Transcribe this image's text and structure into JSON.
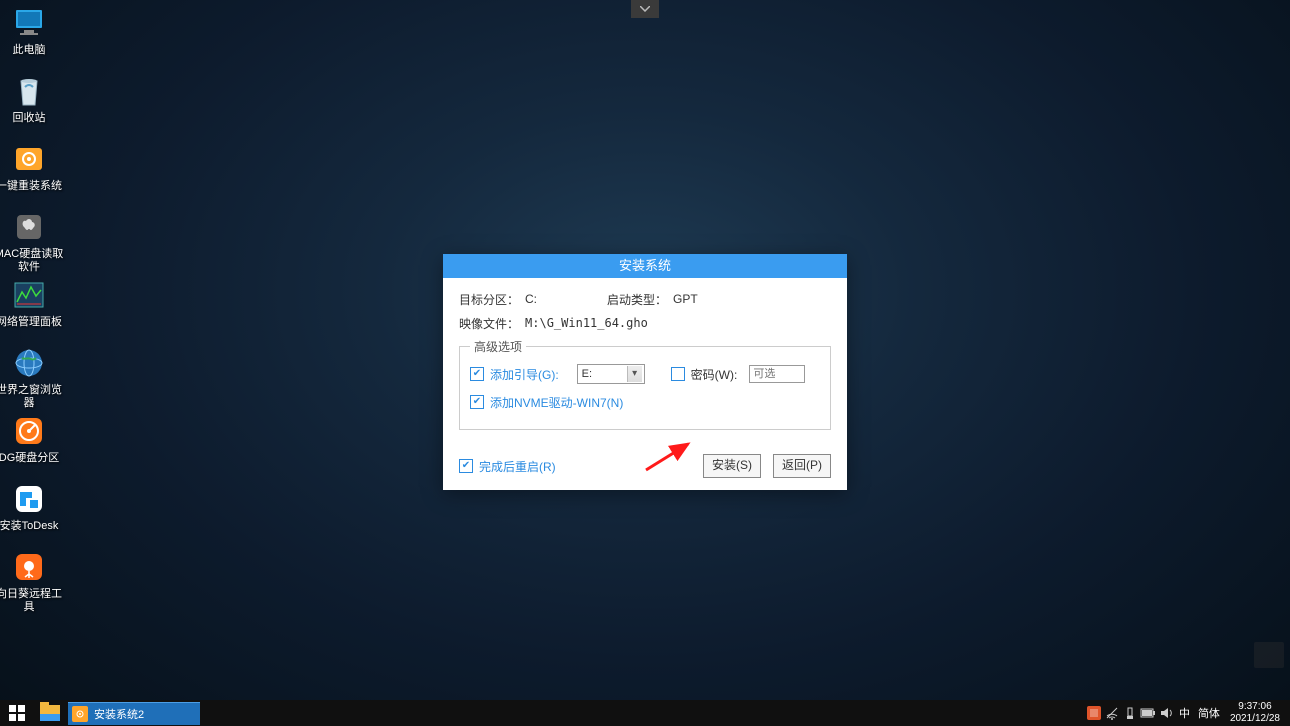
{
  "desktop_icons": [
    {
      "id": "this-pc",
      "label": "此电脑"
    },
    {
      "id": "recycle-bin",
      "label": "回收站"
    },
    {
      "id": "one-click-install",
      "label": "一键重装系统"
    },
    {
      "id": "mac-disk-read",
      "label": "MAC硬盘读取软件"
    },
    {
      "id": "network-panel",
      "label": "网络管理面板"
    },
    {
      "id": "world-browser",
      "label": "世界之窗浏览器"
    },
    {
      "id": "dg-partition",
      "label": "DG硬盘分区"
    },
    {
      "id": "install-todesk",
      "label": "安装ToDesk"
    },
    {
      "id": "sunflower-remote",
      "label": "向日葵远程工具"
    }
  ],
  "dialog": {
    "title": "安装系统",
    "target_label": "目标分区：",
    "target_value": "C:",
    "boot_label": "启动类型：",
    "boot_value": "GPT",
    "image_label": "映像文件：",
    "image_value": "M:\\G_Win11_64.gho",
    "advanced_legend": "高级选项",
    "add_boot_label": "添加引导(G):",
    "add_boot_value": "E:",
    "password_label": "密码(W):",
    "password_placeholder": "可选",
    "nvme_label": "添加NVME驱动-WIN7(N)",
    "restart_label": "完成后重启(R)",
    "install_btn": "安装(S)",
    "back_btn": "返回(P)"
  },
  "taskbar": {
    "app_title": "安装系统2",
    "ime_region": "中",
    "ime_mode": "简体",
    "time": "9:37:06",
    "date": "2021/12/28"
  }
}
